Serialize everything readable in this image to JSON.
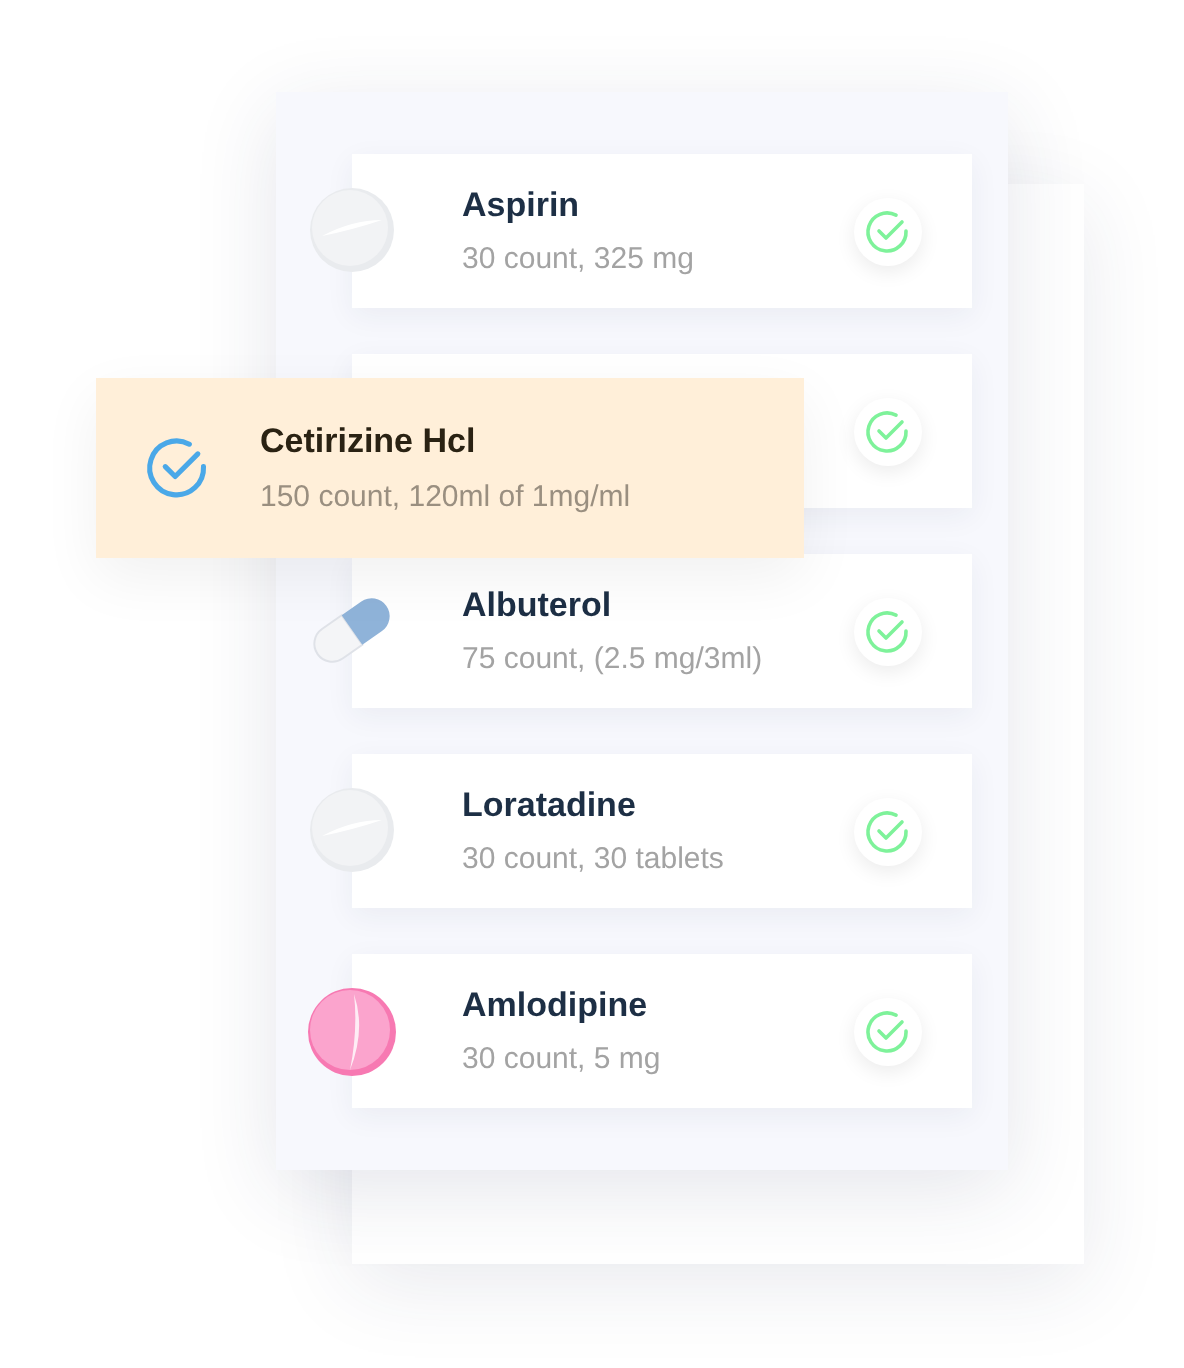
{
  "medications": [
    {
      "kind": "tablet",
      "name": "Aspirin",
      "detail": "30 count, 325 mg",
      "checked": true
    },
    {
      "checked": true
    },
    {
      "kind": "capsule",
      "name": "Albuterol",
      "detail": "75 count, (2.5 mg/3ml)",
      "checked": true
    },
    {
      "kind": "tablet",
      "name": "Loratadine",
      "detail": "30 count, 30 tablets",
      "checked": true
    },
    {
      "kind": "pink-tablet",
      "name": "Amlodipine",
      "detail": "30 count, 5 mg",
      "checked": true
    }
  ],
  "highlight": {
    "name": "Cetirizine Hcl",
    "detail": "150 count, 120ml of 1mg/ml",
    "checked": true
  }
}
